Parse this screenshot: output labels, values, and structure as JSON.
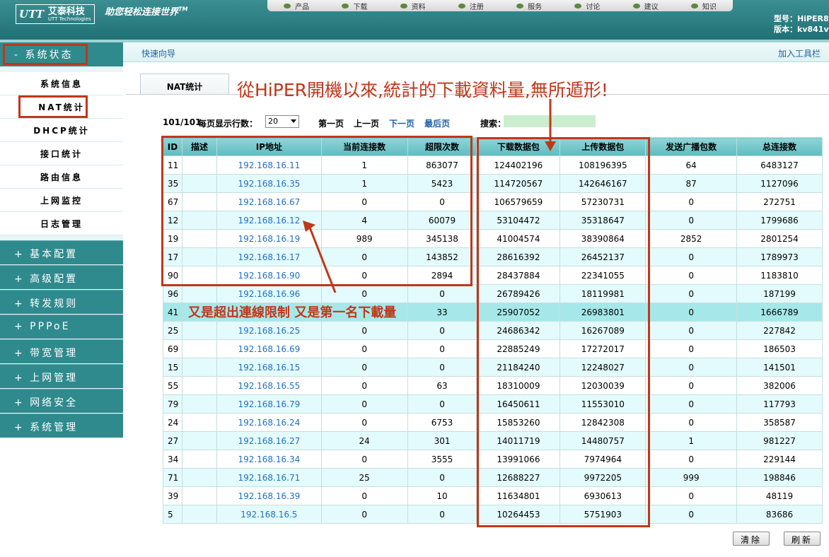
{
  "header": {
    "logo_mark": "UTT",
    "logo_cn": "艾泰科技",
    "logo_en": "UTT Technologies",
    "slogan": "助您轻松连接世界",
    "slogan_tm": "TM",
    "nav_items": [
      "产品",
      "下载",
      "资料",
      "注册",
      "服务",
      "讨论",
      "建议",
      "知识"
    ],
    "model_line": "型号：HiPER8",
    "version_line": "版本：kv841v"
  },
  "sidebar": {
    "status_header": "- 系统状态",
    "sub_items": [
      "系统信息",
      "NAT统计",
      "DHCP统计",
      "接口统计",
      "路由信息",
      "上网监控",
      "日志管理"
    ],
    "main_items": [
      "+ 基本配置",
      "+ 高级配置",
      "+ 转发规则",
      "+ PPPoE",
      "+ 带宽管理",
      "+ 上网管理",
      "+ 网络安全",
      "+ 系统管理"
    ]
  },
  "toolbar": {
    "quick_wizard": "快速向导",
    "add_toolbar": "加入工具栏"
  },
  "tab": {
    "label": "NAT统计"
  },
  "pager": {
    "count": "101/101",
    "rows_label": "每页显示行数：",
    "rows_value": "20",
    "first": "第一页",
    "prev": "上一页",
    "next": "下一页",
    "last": "最后页",
    "search_label": "搜索："
  },
  "table": {
    "headers": [
      "ID",
      "描述",
      "IP地址",
      "当前连接数",
      "超限次数",
      "下载数据包",
      "上传数据包",
      "发送广播包数",
      "总连接数"
    ],
    "rows": [
      [
        "11",
        "",
        "192.168.16.11",
        "1",
        "863077",
        "124402196",
        "108196395",
        "64",
        "6483127"
      ],
      [
        "35",
        "",
        "192.168.16.35",
        "1",
        "5423",
        "114720567",
        "142646167",
        "87",
        "1127096"
      ],
      [
        "67",
        "",
        "192.168.16.67",
        "0",
        "0",
        "106579659",
        "57230731",
        "0",
        "272751"
      ],
      [
        "12",
        "",
        "192.168.16.12",
        "4",
        "60079",
        "53104472",
        "35318647",
        "0",
        "1799686"
      ],
      [
        "19",
        "",
        "192.168.16.19",
        "989",
        "345138",
        "41004574",
        "38390864",
        "2852",
        "2801254"
      ],
      [
        "17",
        "",
        "192.168.16.17",
        "0",
        "143852",
        "28616392",
        "26452137",
        "0",
        "1789973"
      ],
      [
        "90",
        "",
        "192.168.16.90",
        "0",
        "2894",
        "28437884",
        "22341055",
        "0",
        "1183810"
      ],
      [
        "96",
        "",
        "192.168.16.96",
        "0",
        "0",
        "26789426",
        "18119981",
        "0",
        "187199"
      ],
      [
        "41",
        "",
        "",
        "",
        "33",
        "25907052",
        "26983801",
        "0",
        "1666789"
      ],
      [
        "25",
        "",
        "192.168.16.25",
        "0",
        "0",
        "24686342",
        "16267089",
        "0",
        "227842"
      ],
      [
        "69",
        "",
        "192.168.16.69",
        "0",
        "0",
        "22885249",
        "17272017",
        "0",
        "186503"
      ],
      [
        "15",
        "",
        "192.168.16.15",
        "0",
        "0",
        "21184240",
        "12248027",
        "0",
        "141501"
      ],
      [
        "55",
        "",
        "192.168.16.55",
        "0",
        "63",
        "18310009",
        "12030039",
        "0",
        "382006"
      ],
      [
        "79",
        "",
        "192.168.16.79",
        "0",
        "0",
        "16450611",
        "11553010",
        "0",
        "117793"
      ],
      [
        "24",
        "",
        "192.168.16.24",
        "0",
        "6753",
        "15853260",
        "12842308",
        "0",
        "358587"
      ],
      [
        "27",
        "",
        "192.168.16.27",
        "24",
        "301",
        "14011719",
        "14480757",
        "1",
        "981227"
      ],
      [
        "34",
        "",
        "192.168.16.34",
        "0",
        "3555",
        "13991066",
        "7974964",
        "0",
        "229144"
      ],
      [
        "71",
        "",
        "192.168.16.71",
        "25",
        "0",
        "12688227",
        "9972205",
        "999",
        "198846"
      ],
      [
        "39",
        "",
        "192.168.16.39",
        "0",
        "10",
        "11634801",
        "6930613",
        "0",
        "48119"
      ],
      [
        "5",
        "",
        "192.168.16.5",
        "0",
        "0",
        "10264453",
        "5751903",
        "0",
        "83686"
      ]
    ]
  },
  "buttons": {
    "clear": "清除",
    "refresh": "刷新"
  },
  "annotations": {
    "top_note": "從HiPER開機以來,統計的下載資料量,無所遁形!",
    "mid_note": "又是超出連線限制 又是第一名下載量"
  },
  "colors": {
    "teal": "#2f8a8e",
    "annotation_red": "#c0371a",
    "link_blue": "#1f6fc4"
  }
}
